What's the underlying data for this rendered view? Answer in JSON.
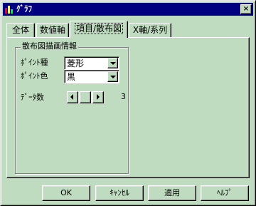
{
  "window": {
    "title": "ｸﾞﾗﾌ",
    "close_label": "×"
  },
  "tabs": [
    {
      "label": "全体",
      "active": false
    },
    {
      "label": "数値軸",
      "active": false
    },
    {
      "label": "項目/散布図",
      "active": true
    },
    {
      "label": "X軸/系列",
      "active": false
    }
  ],
  "group": {
    "title": "散布図描画情報",
    "point_type_label": "ﾎﾟｲﾝﾄ種",
    "point_type_value": "菱形",
    "point_color_label": "ﾎﾟｲﾝﾄ色",
    "point_color_value": "黒",
    "data_count_label": "ﾃﾞｰﾀ数",
    "data_count_value": "3"
  },
  "buttons": {
    "ok": "OK",
    "cancel": "ｷｬﾝｾﾙ",
    "apply": "適用",
    "help": "ﾍﾙﾌﾟ"
  },
  "colors": {
    "background": "#c0dcc0",
    "titlebar": "#000080"
  }
}
